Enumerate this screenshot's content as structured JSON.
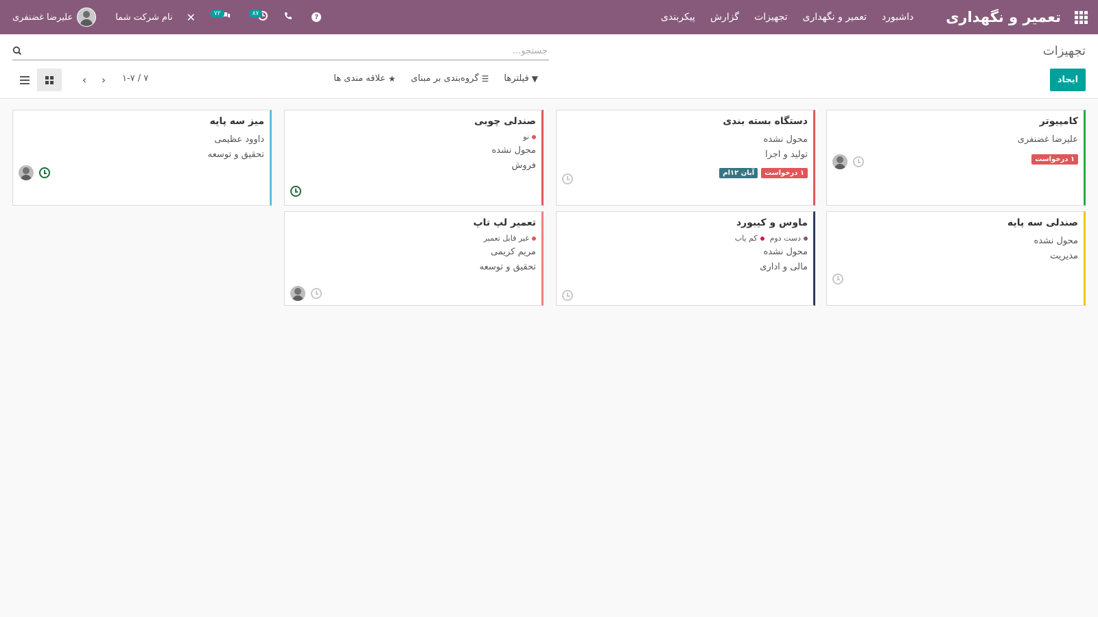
{
  "app": {
    "title": "تعمیر و نگهداری",
    "menu": [
      "داشبورد",
      "تعمیر و نگهداری",
      "تجهیزات",
      "گزارش",
      "پیکربندی"
    ]
  },
  "systray": {
    "user_name": "علیرضا غضنفری",
    "company": "نام شرکت شما",
    "messages_count": "۷۲",
    "activities_count": "۸۷",
    "help": "?"
  },
  "control": {
    "breadcrumb": "تجهیزات",
    "search_placeholder": "جستجو...",
    "create_label": "ایجاد",
    "filters_label": "فیلترها",
    "groupby_label": "گروه‌بندی بر مبنای",
    "favorites_label": "علاقه مندی ها",
    "pager": "۱-۷ / ۷"
  },
  "colors": {
    "navbar": "#875a7b",
    "primary": "#00a09d",
    "badge_red": "#e0565a",
    "badge_teal": "#387481"
  },
  "cards": [
    {
      "title": "کامپیوتر",
      "lines": [
        "علیرضا غضنفری"
      ],
      "badges": [
        {
          "label": "۱ درخواست",
          "color": "#e0565a"
        }
      ],
      "border_color": "#28a745",
      "avatar": true,
      "clock": "gray"
    },
    {
      "title": "دستگاه بسته بندی",
      "lines": [
        "محول نشده",
        "تولید و اجرا"
      ],
      "badges": [
        {
          "label": "۱ درخواست",
          "color": "#e0565a"
        },
        {
          "label": "آبان ۱۲ام",
          "color": "#387481"
        }
      ],
      "border_color": "#e0565a",
      "avatar": false,
      "clock": "gray"
    },
    {
      "title": "صندلی چوبی",
      "tags": [
        {
          "label": "نو",
          "color": "#e0565a"
        }
      ],
      "lines": [
        "محول نشده",
        "فروش"
      ],
      "border_color": "#e0565a",
      "avatar": false,
      "clock": "green"
    },
    {
      "title": "میز سه پایه",
      "lines": [
        "داوود عظیمی",
        "تحقیق و توسعه"
      ],
      "border_color": "#5bc0de",
      "avatar": true,
      "clock": "green"
    },
    {
      "title": "صندلی سه پایه",
      "lines": [
        "محول نشده",
        "مدیریت"
      ],
      "border_color": "#f0c419",
      "avatar": false,
      "clock": "gray"
    },
    {
      "title": "ماوس و کیبورد",
      "tags": [
        {
          "label": "دست دوم",
          "color": "#875a7b"
        },
        {
          "label": "کم یاب",
          "color": "#d6145f"
        }
      ],
      "lines": [
        "محول نشده",
        "مالی و اداری"
      ],
      "border_color": "#2e3b5c",
      "avatar": false,
      "clock": "gray"
    },
    {
      "title": "تعمیر لپ تاپ",
      "tags": [
        {
          "label": "غیر قابل تعمیر",
          "color": "#e0565a"
        }
      ],
      "lines": [
        "مریم کریمی",
        "تحقیق و توسعه"
      ],
      "border_color": "#f08080",
      "avatar": true,
      "clock": "gray"
    }
  ]
}
